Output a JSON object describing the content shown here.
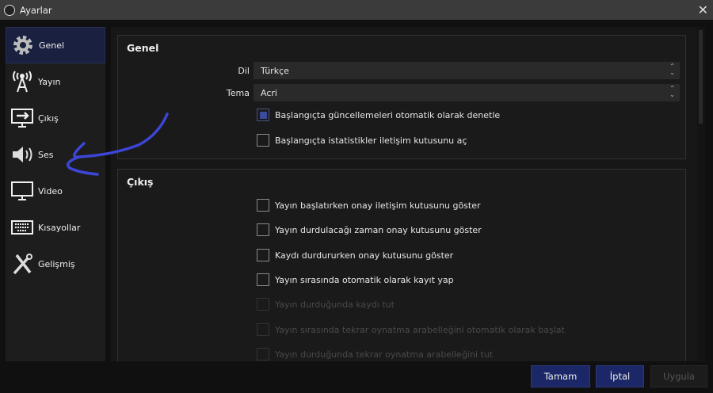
{
  "window": {
    "title": "Ayarlar",
    "close_icon": "close-icon"
  },
  "sidebar": {
    "items": [
      {
        "label": "Genel",
        "icon": "gear-icon",
        "active": true
      },
      {
        "label": "Yayın",
        "icon": "broadcast-icon"
      },
      {
        "label": "Çıkış",
        "icon": "output-icon"
      },
      {
        "label": "Ses",
        "icon": "speaker-icon"
      },
      {
        "label": "Video",
        "icon": "monitor-icon"
      },
      {
        "label": "Kısayollar",
        "icon": "keyboard-icon"
      },
      {
        "label": "Gelişmiş",
        "icon": "tools-icon"
      }
    ]
  },
  "general": {
    "title": "Genel",
    "language": {
      "label": "Dil",
      "value": "Türkçe"
    },
    "theme": {
      "label": "Tema",
      "value": "Acri"
    },
    "checkboxes": [
      {
        "label": "Başlangıçta güncellemeleri otomatik olarak denetle",
        "checked": true
      },
      {
        "label": "Başlangıçta istatistikler iletişim kutusunu aç",
        "checked": false
      }
    ]
  },
  "output": {
    "title": "Çıkış",
    "checkboxes": [
      {
        "label": "Yayın başlatırken onay iletişim kutusunu göster",
        "checked": false,
        "enabled": true
      },
      {
        "label": "Yayın durdulacağı zaman onay kutusunu göster",
        "checked": false,
        "enabled": true
      },
      {
        "label": "Kaydı durdururken onay kutusunu göster",
        "checked": false,
        "enabled": true
      },
      {
        "label": "Yayın sırasında otomatik olarak kayıt yap",
        "checked": false,
        "enabled": true
      },
      {
        "label": "Yayın durduğunda kaydı tut",
        "checked": false,
        "enabled": false
      },
      {
        "label": "Yayın sırasında tekrar oynatma arabelleğini otomatik olarak başlat",
        "checked": false,
        "enabled": false
      },
      {
        "label": "Yayın durduğunda tekrar oynatma arabelleğini tut",
        "checked": false,
        "enabled": false
      }
    ]
  },
  "buttons": {
    "ok": "Tamam",
    "cancel": "İptal",
    "apply": "Uygula"
  },
  "colors": {
    "accent": "#1b2766",
    "annotation": "#3b46d6"
  }
}
